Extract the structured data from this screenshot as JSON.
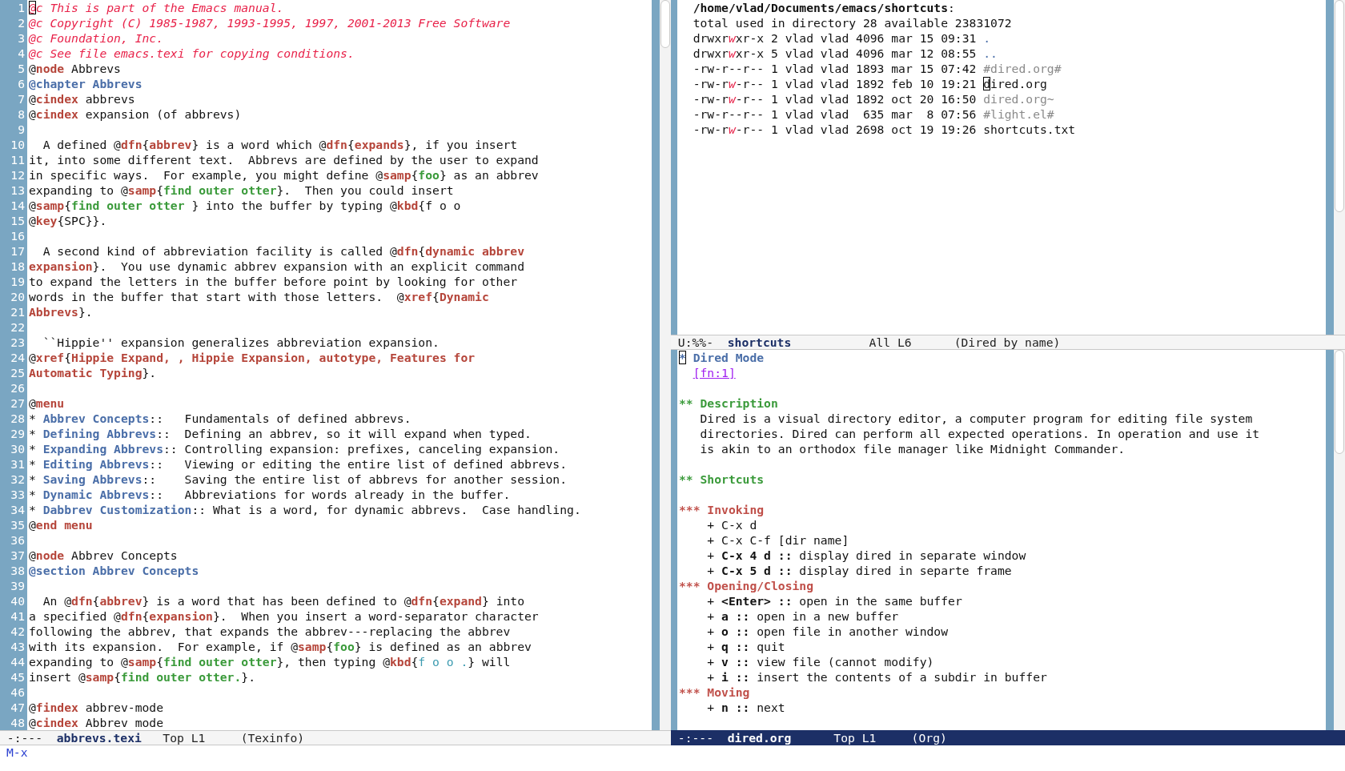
{
  "left_window": {
    "lines": [
      {
        "number": "1",
        "content": [
          {
            "text": "@",
            "kind": "comment",
            "cursor": true
          },
          {
            "text": "c This is part of the Emacs manual.",
            "kind": "comment"
          }
        ]
      },
      {
        "number": "2",
        "content": [
          {
            "text": "@c Copyright (C) 1985-1987, 1993-1995, 1997, 2001-2013 Free Software",
            "kind": "comment"
          }
        ]
      },
      {
        "number": "3",
        "content": [
          {
            "text": "@c Foundation, Inc.",
            "kind": "comment"
          }
        ]
      },
      {
        "number": "4",
        "content": [
          {
            "text": "@c See file emacs.texi for copying conditions.",
            "kind": "comment"
          }
        ]
      },
      {
        "number": "5",
        "content": [
          "@",
          {
            "text": "node",
            "kind": "keyword"
          },
          " Abbrevs"
        ]
      },
      {
        "number": "6",
        "content": [
          {
            "text": "@chapter Abbrevs",
            "kind": "heading"
          }
        ]
      },
      {
        "number": "7",
        "content": [
          "@",
          {
            "text": "cindex",
            "kind": "keyword"
          },
          " abbrevs"
        ]
      },
      {
        "number": "8",
        "content": [
          "@",
          {
            "text": "cindex",
            "kind": "keyword"
          },
          " expansion (of abbrevs)"
        ]
      },
      {
        "number": "9"
      },
      {
        "number": "10",
        "content": [
          "  A defined @",
          {
            "text": "dfn",
            "kind": "keyword"
          },
          "{",
          {
            "text": "abbrev",
            "kind": "argument"
          },
          "} is a word which @",
          {
            "text": "dfn",
            "kind": "keyword"
          },
          "{",
          {
            "text": "expands",
            "kind": "argument"
          },
          "}, if you insert"
        ]
      },
      {
        "number": "11",
        "content": [
          "it, into some different text.  Abbrevs are defined by the user to expand"
        ]
      },
      {
        "number": "12",
        "content": [
          "in specific ways.  For example, you might define @",
          {
            "text": "samp",
            "kind": "keyword"
          },
          "{",
          {
            "text": "foo",
            "kind": "sample"
          },
          "} as an abbrev"
        ]
      },
      {
        "number": "13",
        "content": [
          "expanding to @",
          {
            "text": "samp",
            "kind": "keyword"
          },
          "{",
          {
            "text": "find outer otter",
            "kind": "sample"
          },
          "}.  Then you could insert"
        ]
      },
      {
        "number": "14",
        "content": [
          "@",
          {
            "text": "samp",
            "kind": "keyword"
          },
          "{",
          {
            "text": "find outer otter ",
            "kind": "sample"
          },
          "} into the buffer by typing @",
          {
            "text": "kbd",
            "kind": "keyword"
          },
          "{f o o"
        ]
      },
      {
        "number": "15",
        "content": [
          "@",
          {
            "text": "key",
            "kind": "keyword"
          },
          "{SPC}}."
        ]
      },
      {
        "number": "16"
      },
      {
        "number": "17",
        "content": [
          "  A second kind of abbreviation facility is called @",
          {
            "text": "dfn",
            "kind": "keyword"
          },
          "{",
          {
            "text": "dynamic abbrev",
            "kind": "argument"
          }
        ]
      },
      {
        "number": "18",
        "content": [
          {
            "text": "expansion",
            "kind": "argument"
          },
          "}.  You use dynamic abbrev expansion with an explicit command"
        ]
      },
      {
        "number": "19",
        "content": [
          "to expand the letters in the buffer before point by looking for other"
        ]
      },
      {
        "number": "20",
        "content": [
          "words in the buffer that start with those letters.  @",
          {
            "text": "xref",
            "kind": "keyword"
          },
          "{",
          {
            "text": "Dynamic",
            "kind": "argument"
          }
        ]
      },
      {
        "number": "21",
        "content": [
          {
            "text": "Abbrevs",
            "kind": "argument"
          },
          "}."
        ]
      },
      {
        "number": "22"
      },
      {
        "number": "23",
        "content": [
          "  ``Hippie'' expansion generalizes abbreviation expansion."
        ]
      },
      {
        "number": "24",
        "content": [
          "@",
          {
            "text": "xref",
            "kind": "keyword"
          },
          "{",
          {
            "text": "Hippie Expand, , Hippie Expansion, autotype, Features for",
            "kind": "argument"
          }
        ]
      },
      {
        "number": "25",
        "content": [
          {
            "text": "Automatic Typing",
            "kind": "argument"
          },
          "}."
        ]
      },
      {
        "number": "26"
      },
      {
        "number": "27",
        "content": [
          "@",
          {
            "text": "menu",
            "kind": "keyword"
          }
        ]
      },
      {
        "number": "28",
        "content": [
          "* ",
          {
            "text": "Abbrev Concepts",
            "kind": "menu"
          },
          "::   Fundamentals of defined abbrevs."
        ]
      },
      {
        "number": "29",
        "content": [
          "* ",
          {
            "text": "Defining Abbrevs",
            "kind": "menu"
          },
          "::  Defining an abbrev, so it will expand when typed."
        ]
      },
      {
        "number": "30",
        "content": [
          "* ",
          {
            "text": "Expanding Abbrevs",
            "kind": "menu"
          },
          ":: Controlling expansion: prefixes, canceling expansion."
        ]
      },
      {
        "number": "31",
        "content": [
          "* ",
          {
            "text": "Editing Abbrevs",
            "kind": "menu"
          },
          "::   Viewing or editing the entire list of defined abbrevs."
        ]
      },
      {
        "number": "32",
        "content": [
          "* ",
          {
            "text": "Saving Abbrevs",
            "kind": "menu"
          },
          "::    Saving the entire list of abbrevs for another session."
        ]
      },
      {
        "number": "33",
        "content": [
          "* ",
          {
            "text": "Dynamic Abbrevs",
            "kind": "menu"
          },
          "::   Abbreviations for words already in the buffer."
        ]
      },
      {
        "number": "34",
        "content": [
          "* ",
          {
            "text": "Dabbrev Customization",
            "kind": "menu"
          },
          ":: What is a word, for dynamic abbrevs.  Case handling."
        ]
      },
      {
        "number": "35",
        "content": [
          "@",
          {
            "text": "end menu",
            "kind": "keyword"
          }
        ]
      },
      {
        "number": "36"
      },
      {
        "number": "37",
        "content": [
          "@",
          {
            "text": "node",
            "kind": "keyword"
          },
          " Abbrev Concepts"
        ]
      },
      {
        "number": "38",
        "content": [
          {
            "text": "@section Abbrev Concepts",
            "kind": "heading"
          }
        ]
      },
      {
        "number": "39"
      },
      {
        "number": "40",
        "content": [
          "  An @",
          {
            "text": "dfn",
            "kind": "keyword"
          },
          "{",
          {
            "text": "abbrev",
            "kind": "argument"
          },
          "} is a word that has been defined to @",
          {
            "text": "dfn",
            "kind": "keyword"
          },
          "{",
          {
            "text": "expand",
            "kind": "argument"
          },
          "} into"
        ]
      },
      {
        "number": "41",
        "content": [
          "a specified @",
          {
            "text": "dfn",
            "kind": "keyword"
          },
          "{",
          {
            "text": "expansion",
            "kind": "argument"
          },
          "}.  When you insert a word-separator character"
        ]
      },
      {
        "number": "42",
        "content": [
          "following the abbrev, that expands the abbrev---replacing the abbrev"
        ]
      },
      {
        "number": "43",
        "content": [
          "with its expansion.  For example, if @",
          {
            "text": "samp",
            "kind": "keyword"
          },
          "{",
          {
            "text": "foo",
            "kind": "sample"
          },
          "} is defined as an abbrev"
        ]
      },
      {
        "number": "44",
        "content": [
          "expanding to @",
          {
            "text": "samp",
            "kind": "keyword"
          },
          "{",
          {
            "text": "find outer otter",
            "kind": "sample"
          },
          "}, then typing @",
          {
            "text": "kbd",
            "kind": "keyword"
          },
          "{",
          {
            "text": "f o o .",
            "kind": "keys"
          },
          "} will"
        ]
      },
      {
        "number": "45",
        "content": [
          "insert @",
          {
            "text": "samp",
            "kind": "keyword"
          },
          "{",
          {
            "text": "find outer otter.",
            "kind": "sample"
          },
          "}."
        ]
      },
      {
        "number": "46"
      },
      {
        "number": "47",
        "content": [
          "@",
          {
            "text": "findex",
            "kind": "keyword"
          },
          " abbrev-mode"
        ]
      },
      {
        "number": "48",
        "content": [
          "@",
          {
            "text": "cindex",
            "kind": "keyword"
          },
          " Abbrev mode"
        ]
      }
    ],
    "mode_line": {
      "status": "-:---",
      "buffer": "abbrevs.texi",
      "position": "Top L1",
      "mode": "(Texinfo)",
      "active": false
    }
  },
  "right_top_window": {
    "lines": [
      {
        "content": [
          {
            "text": "  /home/vlad/Documents/emacs/shortcuts",
            "kind": "bold"
          },
          ":"
        ]
      },
      {
        "content": [
          "  total used in directory 28 available 23831072"
        ]
      },
      {
        "content": [
          "  drwxr",
          {
            "text": "w",
            "kind": "perm"
          },
          "xr-x 2 vlad vlad 4096 mar 15 09:31 ",
          {
            "text": ".",
            "kind": "directory"
          }
        ]
      },
      {
        "content": [
          "  drwxr",
          {
            "text": "w",
            "kind": "perm"
          },
          "xr-x 5 vlad vlad 4096 mar 12 08:55 ",
          {
            "text": "..",
            "kind": "directory"
          }
        ]
      },
      {
        "content": [
          "  -rw-r--r-- 1 vlad vlad 1893 mar 15 07:42 ",
          {
            "text": "#dired.org#",
            "kind": "ignored"
          }
        ]
      },
      {
        "content": [
          "  -rw-r",
          {
            "text": "w",
            "kind": "perm"
          },
          "-r-- 1 vlad vlad 1892 feb 10 19:21 ",
          {
            "text": "d",
            "cursor": true
          },
          "ired.org"
        ]
      },
      {
        "content": [
          "  -rw-r",
          {
            "text": "w",
            "kind": "perm"
          },
          "-r-- 1 vlad vlad 1892 oct 20 16:50 ",
          {
            "text": "dired.org~",
            "kind": "ignored"
          }
        ]
      },
      {
        "content": [
          "  -rw-r--r-- 1 vlad vlad  635 mar  8 07:56 ",
          {
            "text": "#light.el#",
            "kind": "ignored"
          }
        ]
      },
      {
        "content": [
          "  -rw-r",
          {
            "text": "w",
            "kind": "perm"
          },
          "-r-- 1 vlad vlad 2698 oct 19 19:26 shortcuts.txt"
        ]
      }
    ],
    "mode_line": {
      "status": "U:%%-",
      "buffer": "shortcuts",
      "position": "All L6",
      "mode": "(Dired by name)",
      "active": false
    }
  },
  "right_bottom_window": {
    "lines": [
      {
        "content": [
          {
            "text": "*",
            "kind": "level1",
            "cursor": true
          },
          {
            "text": " Dired Mode",
            "kind": "level1"
          }
        ]
      },
      {
        "content": [
          {
            "text": "[fn:1]",
            "kind": "footnote"
          }
        ]
      },
      {
        "content": [
          {
            "text": "** Description",
            "kind": "level2"
          }
        ],
        "space_before": true
      },
      {
        "content": [
          "   Dired is a visual directory editor, a computer program for editing file system"
        ]
      },
      {
        "content": [
          "   directories. Dired can perform all expected operations. In operation and use it"
        ]
      },
      {
        "content": [
          "   is akin to an orthodox file manager like Midnight Commander."
        ]
      },
      {
        "content": [
          {
            "text": "** Shortcuts",
            "kind": "level2"
          }
        ],
        "space_before": true
      },
      {
        "content": [
          {
            "text": "*** Invoking",
            "kind": "level3"
          }
        ],
        "space_before": true
      },
      {
        "content": [
          "    + C-x d"
        ]
      },
      {
        "content": [
          "    + C-x C-f [dir name]"
        ]
      },
      {
        "content": [
          "    + ",
          {
            "text": "C-x 4 d ::",
            "kind": "bold"
          },
          " display dired in separate window"
        ]
      },
      {
        "content": [
          "    + ",
          {
            "text": "C-x 5 d ::",
            "kind": "bold"
          },
          " display dired in separte frame"
        ]
      },
      {
        "content": [
          {
            "text": "*** Opening/Closing",
            "kind": "level3"
          }
        ]
      },
      {
        "content": [
          "    + ",
          {
            "text": "<Enter> ::",
            "kind": "bold"
          },
          " open in the same buffer"
        ]
      },
      {
        "content": [
          "    + ",
          {
            "text": "a ::",
            "kind": "bold"
          },
          " open in a new buffer"
        ]
      },
      {
        "content": [
          "    + ",
          {
            "text": "o ::",
            "kind": "bold"
          },
          " open file in another window"
        ]
      },
      {
        "content": [
          "    + ",
          {
            "text": "q ::",
            "kind": "bold"
          },
          " quit"
        ]
      },
      {
        "content": [
          "    + ",
          {
            "text": "v ::",
            "kind": "bold"
          },
          " view file (cannot modify)"
        ]
      },
      {
        "content": [
          "    + ",
          {
            "text": "i ::",
            "kind": "bold"
          },
          " insert the contents of a subdir in buffer"
        ]
      },
      {
        "content": [
          {
            "text": "*** Moving",
            "kind": "level3"
          }
        ]
      },
      {
        "content": [
          "    + ",
          {
            "text": "n ::",
            "kind": "bold"
          },
          " next"
        ]
      }
    ],
    "mode_line": {
      "status": "-:---",
      "buffer": "dired.org",
      "position": "Top L1",
      "mode": "(Org)",
      "active": true
    }
  },
  "minibuffer": {
    "prompt": "M-x"
  }
}
